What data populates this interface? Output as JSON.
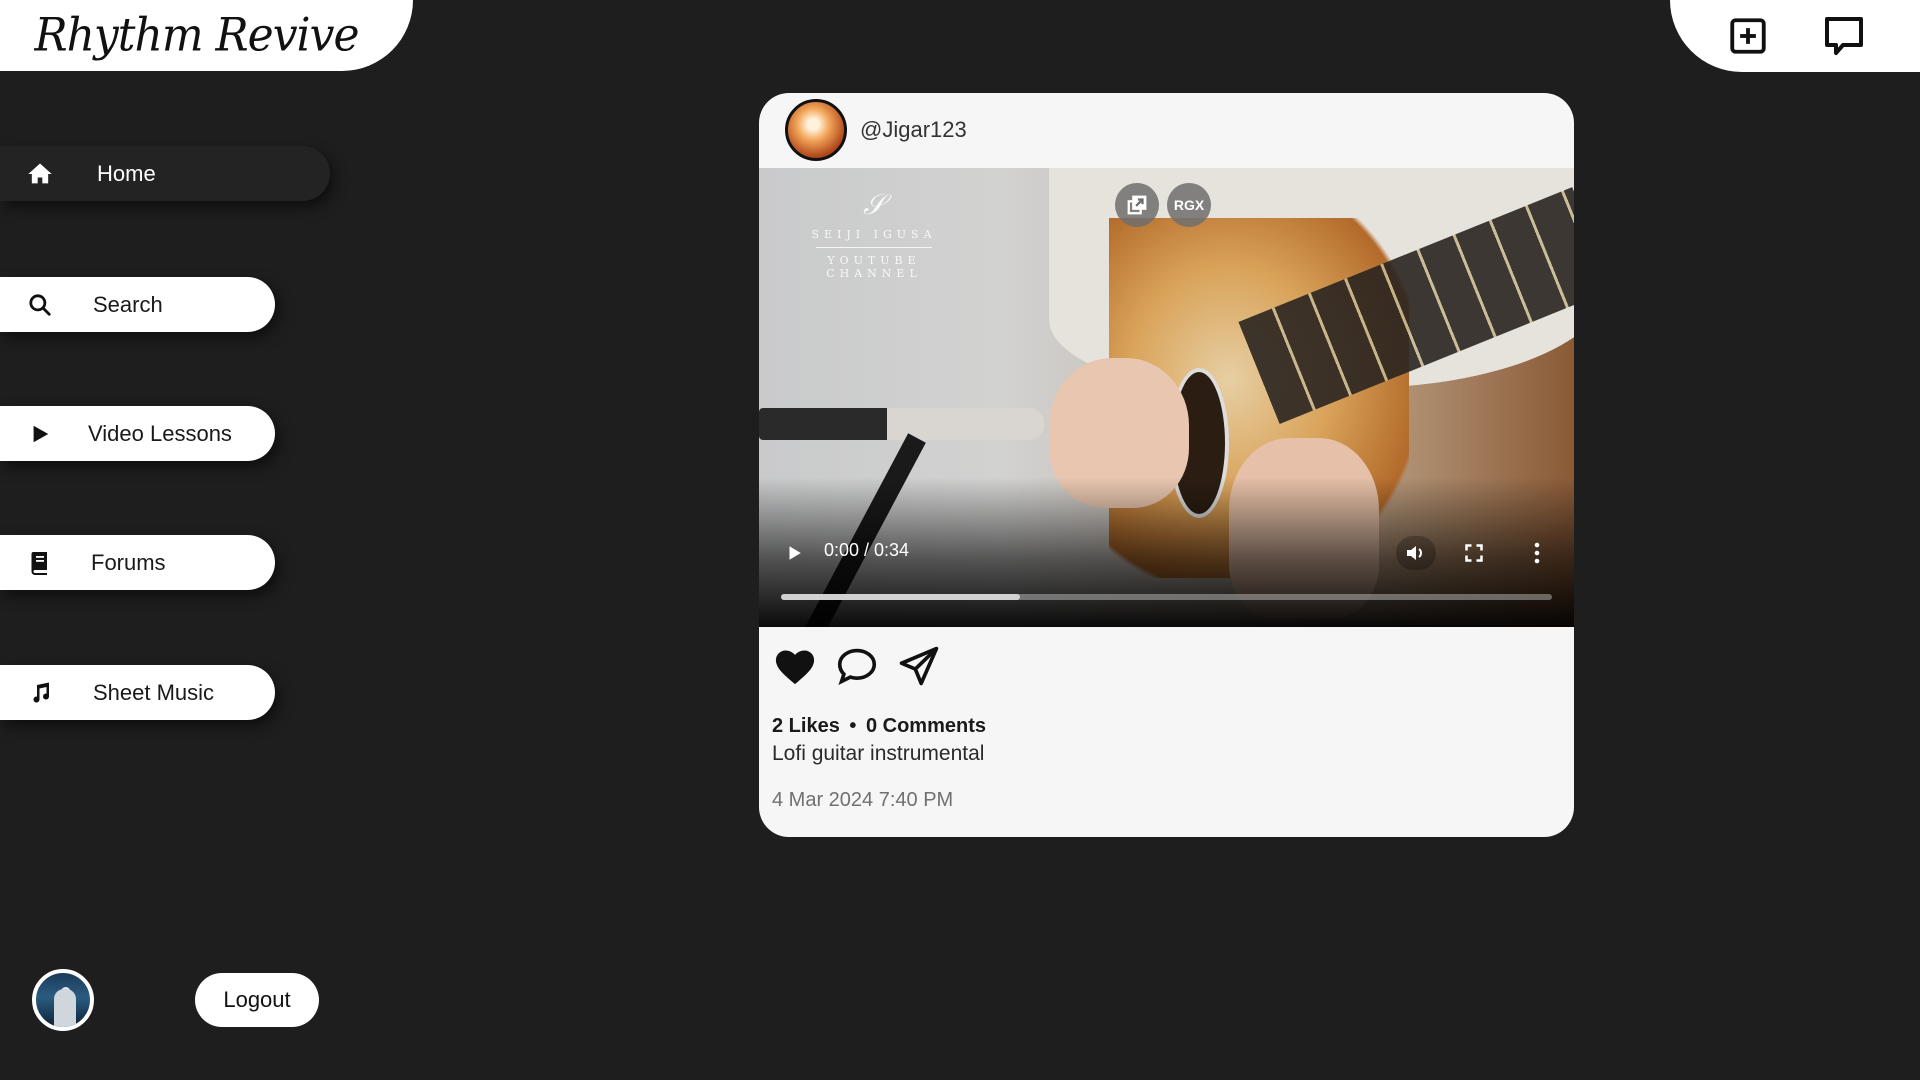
{
  "app": {
    "name": "Rhythm Revive"
  },
  "header": {
    "actions": [
      {
        "name": "create-post",
        "icon": "plus-square-icon"
      },
      {
        "name": "messages",
        "icon": "chat-bubble-icon"
      }
    ]
  },
  "sidebar": {
    "items": [
      {
        "label": "Home",
        "icon": "home-icon",
        "active": true
      },
      {
        "label": "Search",
        "icon": "search-icon",
        "active": false
      },
      {
        "label": "Video Lessons",
        "icon": "play-icon",
        "active": false
      },
      {
        "label": "Forums",
        "icon": "book-icon",
        "active": false
      },
      {
        "label": "Sheet Music",
        "icon": "music-note-icon",
        "active": false
      }
    ],
    "logout_label": "Logout"
  },
  "post": {
    "username": "@Jigar123",
    "video": {
      "watermark_line1": "SEIJI IGUSA",
      "watermark_line2": "YOUTUBE CHANNEL",
      "overlay_badge": "RGX",
      "current_time": "0:00",
      "duration": "0:34",
      "time_display": "0:00 / 0:34",
      "buffered_fraction": 0.31
    },
    "likes": "2 Likes",
    "separator": "•",
    "comments": "0 Comments",
    "caption": "Lofi guitar instrumental",
    "timestamp": "4 Mar 2024 7:40 PM"
  },
  "colors": {
    "background": "#1e1e1e",
    "card": "#f6f6f6",
    "nav_active": "#232323",
    "nav_inactive": "#ffffff"
  }
}
